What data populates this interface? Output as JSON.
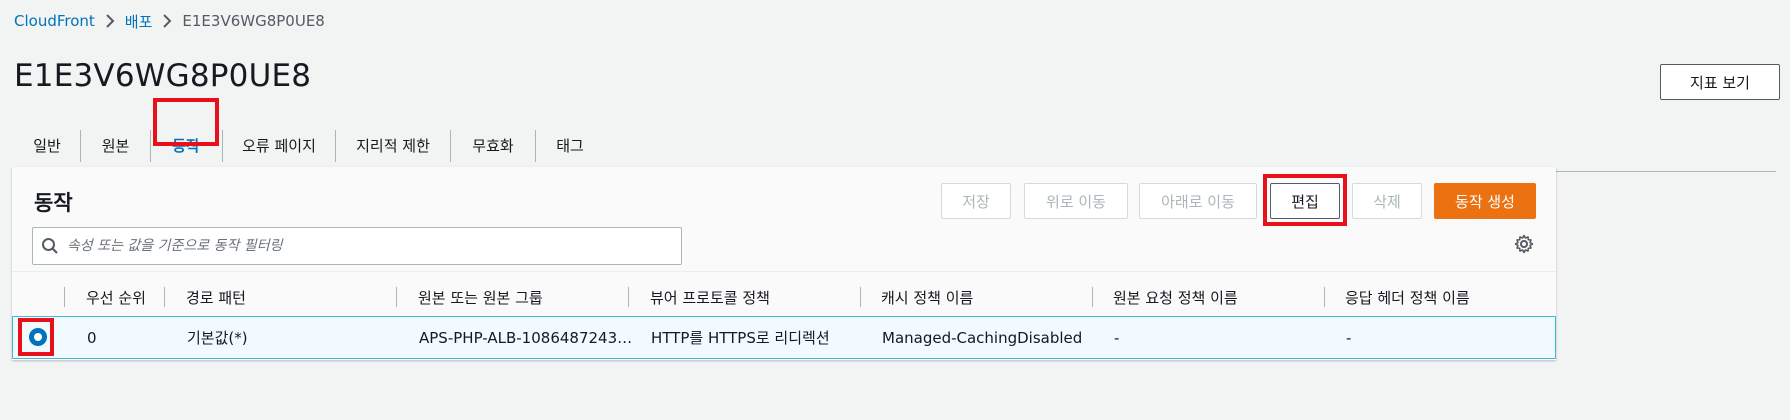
{
  "breadcrumb": {
    "root": "CloudFront",
    "parent": "배포",
    "current": "E1E3V6WG8P0UE8"
  },
  "page": {
    "title": "E1E3V6WG8P0UE8",
    "metrics_button": "지표 보기"
  },
  "tabs": [
    {
      "label": "일반"
    },
    {
      "label": "원본"
    },
    {
      "label": "동작",
      "active": true
    },
    {
      "label": "오류 페이지"
    },
    {
      "label": "지리적 제한"
    },
    {
      "label": "무효화"
    },
    {
      "label": "태그"
    }
  ],
  "panel": {
    "title": "동작",
    "buttons": {
      "save": "저장",
      "move_up": "위로 이동",
      "move_down": "아래로 이동",
      "edit": "편집",
      "delete": "삭제",
      "create": "동작 생성"
    },
    "search_placeholder": "속성 또는 값을 기준으로 동작 필터링"
  },
  "table": {
    "columns": [
      "우선 순위",
      "경로 패턴",
      "원본 또는 원본 그룹",
      "뷰어 프로토콜 정책",
      "캐시 정책 이름",
      "원본 요청 정책 이름",
      "응답 헤더 정책 이름"
    ],
    "rows": [
      {
        "selected": true,
        "cells": [
          "0",
          "기본값(*)",
          "APS-PHP-ALB-1086487243…",
          "HTTP를 HTTPS로 리디렉션",
          "Managed-CachingDisabled",
          "-",
          "-"
        ]
      }
    ]
  },
  "colors": {
    "link": "#0073bb",
    "primary": "#ec7211",
    "highlight": "#e8101a",
    "selected_row_border": "#44b9d6"
  },
  "icons": [
    "chevron-right-icon",
    "search-icon",
    "gear-icon",
    "radio-selected-icon"
  ]
}
